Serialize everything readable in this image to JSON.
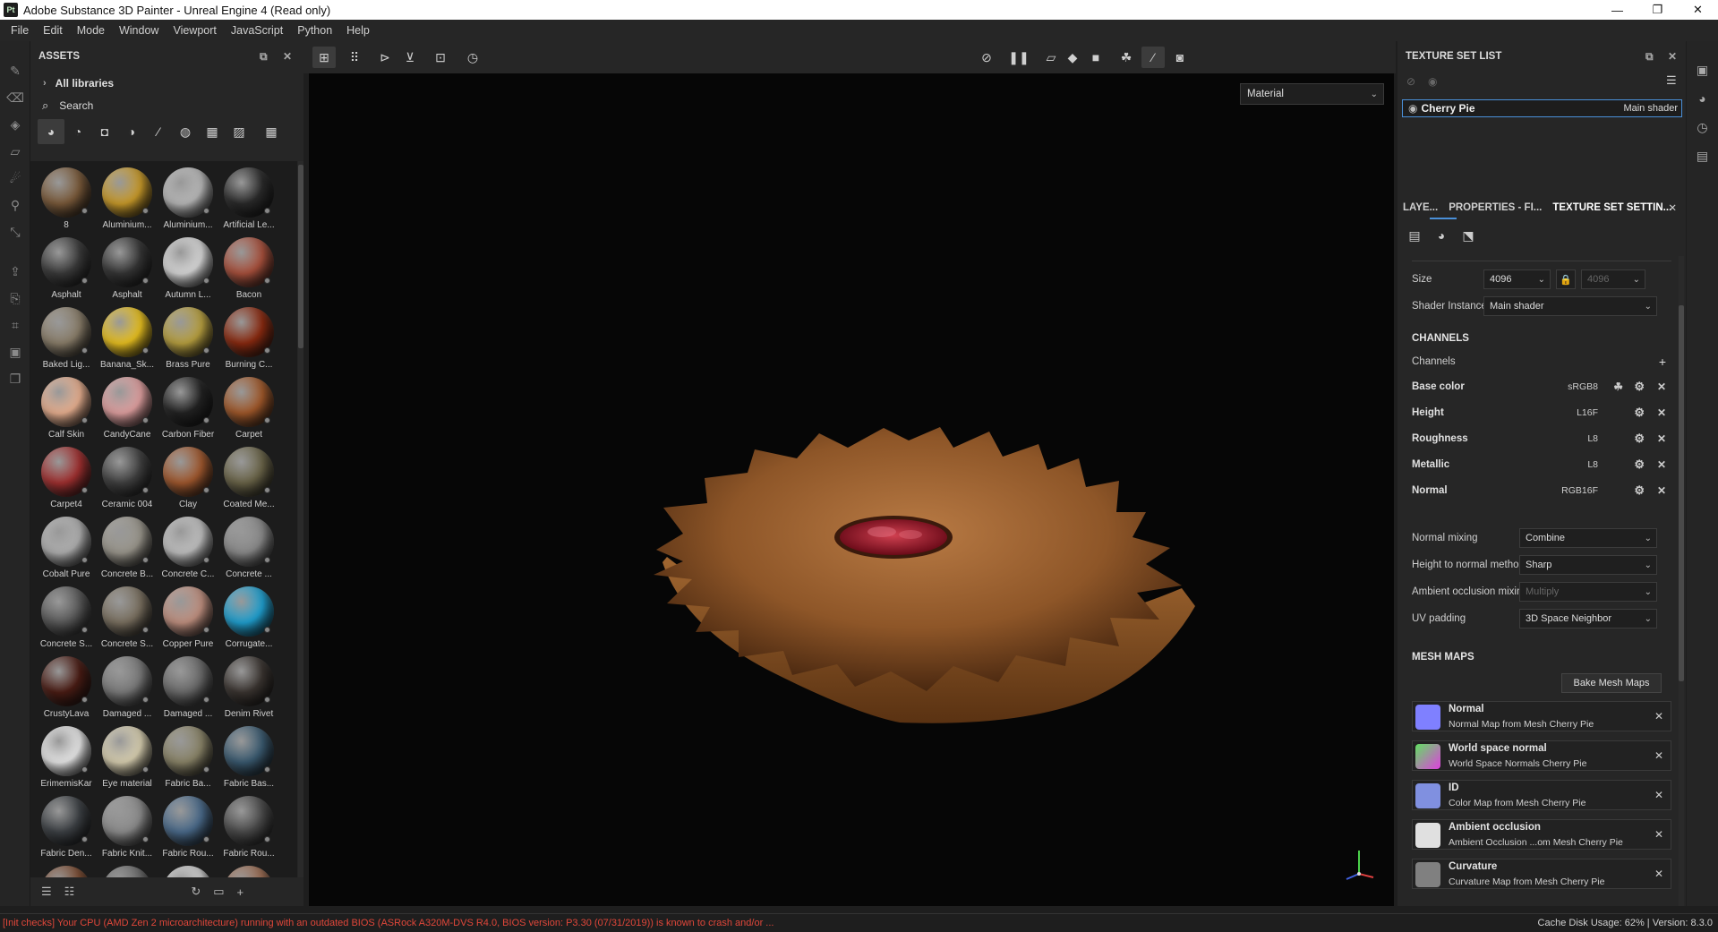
{
  "window": {
    "app_icon": "Pt",
    "title": "Adobe Substance 3D Painter - Unreal Engine 4 (Read only)",
    "controls": [
      "—",
      "❐",
      "✕"
    ]
  },
  "menu": [
    "File",
    "Edit",
    "Mode",
    "Window",
    "Viewport",
    "JavaScript",
    "Python",
    "Help"
  ],
  "assets": {
    "title": "ASSETS",
    "library": "All libraries",
    "search_placeholder": "Search",
    "materials": [
      {
        "label": "8",
        "color": "#7a5a3a"
      },
      {
        "label": "Aluminium...",
        "color": "#c89a2a"
      },
      {
        "label": "Aluminium...",
        "color": "#b8b8b8"
      },
      {
        "label": "Artificial Le...",
        "color": "#2a2a2a"
      },
      {
        "label": "Asphalt",
        "color": "#3a3a3a"
      },
      {
        "label": "Asphalt",
        "color": "#353535"
      },
      {
        "label": "Autumn L...",
        "color": "#d8d8d8"
      },
      {
        "label": "Bacon",
        "color": "#a8503c"
      },
      {
        "label": "Baked Lig...",
        "color": "#8a7e6a"
      },
      {
        "label": "Banana_Sk...",
        "color": "#e8c020"
      },
      {
        "label": "Brass Pure",
        "color": "#b8a040"
      },
      {
        "label": "Burning C...",
        "color": "#8a2a10"
      },
      {
        "label": "Calf Skin",
        "color": "#e8b090"
      },
      {
        "label": "CandyCane",
        "color": "#e0a0a0"
      },
      {
        "label": "Carbon Fiber",
        "color": "#222222"
      },
      {
        "label": "Carpet",
        "color": "#a0582a"
      },
      {
        "label": "Carpet4",
        "color": "#a03030"
      },
      {
        "label": "Ceramic 004",
        "color": "#404040"
      },
      {
        "label": "Clay",
        "color": "#a0582e"
      },
      {
        "label": "Coated Me...",
        "color": "#6a6448"
      },
      {
        "label": "Cobalt Pure",
        "color": "#b0b0b0"
      },
      {
        "label": "Concrete B...",
        "color": "#9a968c"
      },
      {
        "label": "Concrete C...",
        "color": "#c0c0c0"
      },
      {
        "label": "Concrete ...",
        "color": "#8a8a8a"
      },
      {
        "label": "Concrete S...",
        "color": "#5a5a5a"
      },
      {
        "label": "Concrete S...",
        "color": "#7a7060"
      },
      {
        "label": "Copper Pure",
        "color": "#c09080"
      },
      {
        "label": "Corrugate...",
        "color": "#20a0d0"
      },
      {
        "label": "CrustyLava",
        "color": "#4a1c14"
      },
      {
        "label": "Damaged ...",
        "color": "#7a7a7a"
      },
      {
        "label": "Damaged ...",
        "color": "#6a6a6a"
      },
      {
        "label": "Denim Rivet",
        "color": "#3a3430"
      },
      {
        "label": "ErimemisKar",
        "color": "#e8e8e8"
      },
      {
        "label": "Eye material",
        "color": "#d8cfb0"
      },
      {
        "label": "Fabric Ba...",
        "color": "#8a8468"
      },
      {
        "label": "Fabric Bas...",
        "color": "#3a5a70"
      },
      {
        "label": "Fabric Den...",
        "color": "#3c4044"
      },
      {
        "label": "Fabric Knit...",
        "color": "#8c8c8c"
      },
      {
        "label": "Fabric Rou...",
        "color": "#4a6a8a"
      },
      {
        "label": "Fabric Rou...",
        "color": "#4a4a4a"
      },
      {
        "label": "",
        "color": "#7a4a30"
      },
      {
        "label": "",
        "color": "#6a6a6a"
      },
      {
        "label": "",
        "color": "#d0d0d0"
      },
      {
        "label": "",
        "color": "#9a6a50"
      }
    ]
  },
  "viewport": {
    "mode_select": "Material"
  },
  "texture_set_list": {
    "title": "TEXTURE SET LIST",
    "item_name": "Cherry Pie",
    "item_shader": "Main shader"
  },
  "tabs": {
    "layers": "LAYE...",
    "properties": "PROPERTIES - FI...",
    "texture_set_settings": "TEXTURE SET SETTIN..."
  },
  "settings": {
    "size_label": "Size",
    "size_value": "4096",
    "size_value_locked": "4096",
    "shader_instance_label": "Shader Instance",
    "shader_instance_value": "Main shader",
    "channels_header": "CHANNELS",
    "channels_label": "Channels",
    "channels": [
      {
        "name": "Base color",
        "format": "sRGB8"
      },
      {
        "name": "Height",
        "format": "L16F"
      },
      {
        "name": "Roughness",
        "format": "L8"
      },
      {
        "name": "Metallic",
        "format": "L8"
      },
      {
        "name": "Normal",
        "format": "RGB16F"
      }
    ],
    "normal_mixing_label": "Normal mixing",
    "normal_mixing_value": "Combine",
    "height_to_normal_label": "Height to normal method",
    "height_to_normal_value": "Sharp",
    "ao_mixing_label": "Ambient occlusion mixing",
    "ao_mixing_value": "Multiply",
    "uv_padding_label": "UV padding",
    "uv_padding_value": "3D Space Neighbor",
    "mesh_maps_header": "MESH MAPS",
    "bake_button": "Bake Mesh Maps",
    "mesh_maps": [
      {
        "name": "Normal",
        "desc": "Normal Map from Mesh Cherry Pie",
        "color": "#7f80ff"
      },
      {
        "name": "World space normal",
        "desc": "World Space Normals Cherry Pie",
        "color": "#60c080"
      },
      {
        "name": "ID",
        "desc": "Color Map from Mesh Cherry Pie",
        "color": "#8090e0"
      },
      {
        "name": "Ambient occlusion",
        "desc": "Ambient Occlusion ...om Mesh Cherry Pie",
        "color": "#e0e0e0"
      },
      {
        "name": "Curvature",
        "desc": "Curvature Map from Mesh Cherry Pie",
        "color": "#808080"
      }
    ]
  },
  "status": {
    "error": "[Init checks] Your CPU (AMD Zen 2 microarchitecture) running with an outdated BIOS (ASRock A320M-DVS R4.0, BIOS version: P3.30 (07/31/2019)) is known to crash and/or ...",
    "cache": "Cache Disk Usage:  62% | Version: 8.3.0"
  },
  "colors": {
    "accent": "#4a90d9",
    "error": "#e0473a"
  }
}
